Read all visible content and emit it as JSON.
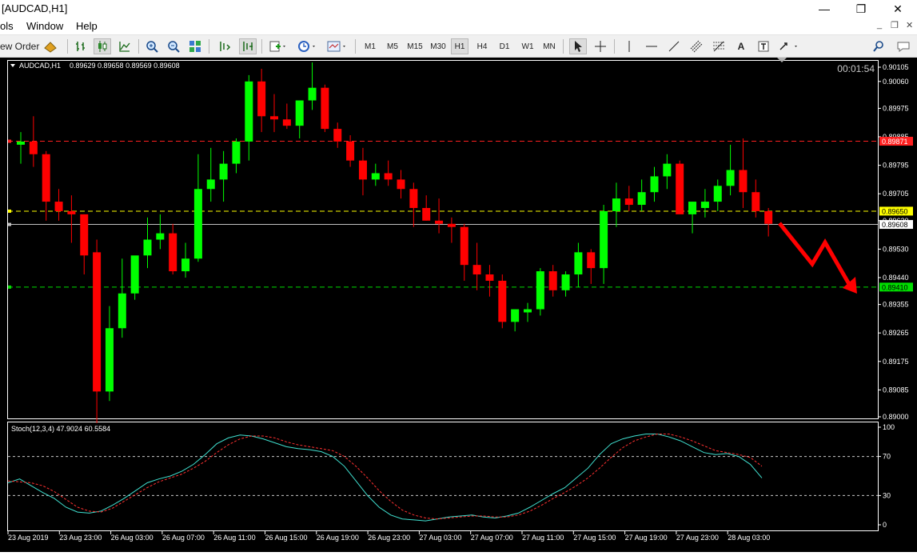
{
  "window": {
    "title": "[AUDCAD,H1]",
    "minimize_glyph": "—",
    "restore_glyph": "❐",
    "close_glyph": "✕"
  },
  "menu": {
    "items": [
      "ols",
      "Window",
      "Help"
    ],
    "mdi_minimize": "_",
    "mdi_restore": "❐",
    "mdi_close": "✕"
  },
  "toolbar": {
    "new_order_label": "ew Order",
    "timeframes": [
      "M1",
      "M5",
      "M15",
      "M30",
      "H1",
      "H4",
      "D1",
      "W1",
      "MN"
    ],
    "active_timeframe": "H1",
    "text_tool": "A",
    "icons": [
      "autotrading-icon",
      "bar-chart-icon",
      "candlestick-icon",
      "line-chart-icon",
      "zoom-in-icon",
      "zoom-out-icon",
      "tile-windows-icon",
      "chart-shift-icon",
      "autoscroll-icon",
      "indicators-icon",
      "periods-clock-icon",
      "templates-icon",
      "cursor-icon",
      "crosshair-icon",
      "vertical-line-icon",
      "horizontal-line-icon",
      "trendline-icon",
      "fibonacci-icon",
      "channel-icon",
      "text-label-icon",
      "arrows-icon",
      "search-icon",
      "chat-icon"
    ]
  },
  "chart_data": [
    {
      "type": "candlestick",
      "symbol_header": "AUDCAD,H1",
      "ohlc_header": "0.89629 0.89658 0.89569 0.89608",
      "timer": "00:01:54",
      "price_axis_ticks": [
        "0.90105",
        "0.90060",
        "0.89975",
        "0.89885",
        "0.89795",
        "0.89705",
        "0.89620",
        "0.89530",
        "0.89440",
        "0.89355",
        "0.89265",
        "0.89175",
        "0.89085",
        "0.89000"
      ],
      "y_range": [
        0.89,
        0.90105
      ],
      "levels": [
        {
          "price": 0.89871,
          "label": "0.89871",
          "color": "#ff2020",
          "style": "dashed"
        },
        {
          "price": 0.8965,
          "label": "0.89650",
          "color": "#ffff00",
          "style": "dashed"
        },
        {
          "price": 0.89608,
          "label": "0.89608",
          "color": "#c0c0c0",
          "style": "solid"
        },
        {
          "price": 0.8941,
          "label": "0.89410",
          "color": "#00dd00",
          "style": "dashed"
        }
      ],
      "candles": [
        [
          0.8986,
          0.899,
          0.898,
          0.8987
        ],
        [
          0.8987,
          0.8995,
          0.8979,
          0.8983
        ],
        [
          0.8983,
          0.8984,
          0.8962,
          0.8968
        ],
        [
          0.8968,
          0.8972,
          0.8962,
          0.8965
        ],
        [
          0.8965,
          0.897,
          0.8955,
          0.8964
        ],
        [
          0.8964,
          0.8964,
          0.8945,
          0.8951
        ],
        [
          0.8952,
          0.8956,
          0.8898,
          0.8908
        ],
        [
          0.8908,
          0.8935,
          0.8905,
          0.8928
        ],
        [
          0.8928,
          0.895,
          0.8925,
          0.8939
        ],
        [
          0.8939,
          0.895,
          0.8937,
          0.8951
        ],
        [
          0.8951,
          0.8963,
          0.8947,
          0.8956
        ],
        [
          0.8956,
          0.8964,
          0.8953,
          0.8958
        ],
        [
          0.8958,
          0.8961,
          0.8945,
          0.8946
        ],
        [
          0.8946,
          0.8955,
          0.8944,
          0.895
        ],
        [
          0.895,
          0.8983,
          0.8949,
          0.8972
        ],
        [
          0.8972,
          0.8985,
          0.8968,
          0.8975
        ],
        [
          0.8975,
          0.8984,
          0.8968,
          0.898
        ],
        [
          0.898,
          0.8988,
          0.8977,
          0.8987
        ],
        [
          0.8987,
          0.9008,
          0.8981,
          0.9006
        ],
        [
          0.9006,
          0.901,
          0.899,
          0.8995
        ],
        [
          0.8995,
          0.9002,
          0.899,
          0.8994
        ],
        [
          0.8994,
          0.8999,
          0.8991,
          0.8992
        ],
        [
          0.8992,
          0.9,
          0.8988,
          0.9
        ],
        [
          0.9,
          0.9012,
          0.8997,
          0.9004
        ],
        [
          0.9004,
          0.9005,
          0.899,
          0.8991
        ],
        [
          0.8991,
          0.8993,
          0.8985,
          0.8987
        ],
        [
          0.8987,
          0.8989,
          0.8979,
          0.8981
        ],
        [
          0.8981,
          0.8985,
          0.897,
          0.8975
        ],
        [
          0.8975,
          0.898,
          0.8973,
          0.8977
        ],
        [
          0.8977,
          0.8981,
          0.8973,
          0.8975
        ],
        [
          0.8975,
          0.8978,
          0.8969,
          0.8972
        ],
        [
          0.8972,
          0.8974,
          0.896,
          0.8966
        ],
        [
          0.8966,
          0.897,
          0.8962,
          0.8962
        ],
        [
          0.8962,
          0.8969,
          0.8958,
          0.8961
        ],
        [
          0.8961,
          0.8963,
          0.8955,
          0.896
        ],
        [
          0.896,
          0.8961,
          0.8943,
          0.8948
        ],
        [
          0.8948,
          0.8955,
          0.894,
          0.8945
        ],
        [
          0.8945,
          0.8948,
          0.8938,
          0.8943
        ],
        [
          0.8943,
          0.8945,
          0.8928,
          0.893
        ],
        [
          0.893,
          0.8934,
          0.8927,
          0.8934
        ],
        [
          0.8933,
          0.8936,
          0.893,
          0.8934
        ],
        [
          0.8934,
          0.8947,
          0.8932,
          0.8946
        ],
        [
          0.8946,
          0.8948,
          0.8938,
          0.894
        ],
        [
          0.894,
          0.8946,
          0.8938,
          0.8945
        ],
        [
          0.8945,
          0.8955,
          0.8941,
          0.8952
        ],
        [
          0.8952,
          0.8953,
          0.8942,
          0.8947
        ],
        [
          0.8947,
          0.8967,
          0.8942,
          0.8965
        ],
        [
          0.8965,
          0.8974,
          0.896,
          0.8969
        ],
        [
          0.8969,
          0.8973,
          0.8965,
          0.8967
        ],
        [
          0.8967,
          0.8975,
          0.8965,
          0.8971
        ],
        [
          0.8971,
          0.8979,
          0.8968,
          0.8976
        ],
        [
          0.8976,
          0.8983,
          0.8972,
          0.898
        ],
        [
          0.898,
          0.8981,
          0.8965,
          0.8964
        ],
        [
          0.8964,
          0.8968,
          0.8958,
          0.8968
        ],
        [
          0.8966,
          0.8972,
          0.8963,
          0.8968
        ],
        [
          0.8968,
          0.8975,
          0.8965,
          0.8973
        ],
        [
          0.8973,
          0.8986,
          0.897,
          0.8978
        ],
        [
          0.8978,
          0.8988,
          0.8966,
          0.8971
        ],
        [
          0.8971,
          0.8975,
          0.8963,
          0.8965
        ],
        [
          0.8965,
          0.8966,
          0.8957,
          0.8961
        ]
      ],
      "bull_color": "#00ff00",
      "bear_color": "#ff0000",
      "forecast_arrow_color": "#ff0000"
    },
    {
      "type": "line",
      "title": "Stoch(12,3,4) 47.9024 60.5584",
      "y_range": [
        0,
        100
      ],
      "y_ticks": [
        "100",
        "70",
        "30",
        "0"
      ],
      "levels": [
        70,
        30
      ],
      "series": [
        {
          "color": "#40e0d0",
          "style": "solid",
          "values": [
            43,
            47,
            40,
            33,
            27,
            18,
            13,
            12,
            14,
            20,
            27,
            35,
            43,
            47,
            50,
            55,
            62,
            72,
            83,
            89,
            92,
            91,
            88,
            84,
            80,
            78,
            77,
            75,
            70,
            60,
            45,
            30,
            18,
            10,
            6,
            5,
            4,
            6,
            8,
            9,
            10,
            8,
            7,
            9,
            12,
            18,
            25,
            32,
            38,
            48,
            58,
            72,
            83,
            88,
            91,
            93,
            93,
            90,
            86,
            80,
            74,
            72,
            73,
            70,
            62,
            48
          ]
        },
        {
          "color": "#ff3030",
          "style": "dashed",
          "values": [
            45,
            44,
            43,
            40,
            34,
            26,
            18,
            14,
            13,
            17,
            24,
            31,
            38,
            44,
            48,
            52,
            58,
            65,
            74,
            82,
            88,
            91,
            91,
            89,
            85,
            82,
            80,
            78,
            76,
            70,
            60,
            48,
            35,
            24,
            15,
            10,
            7,
            6,
            7,
            8,
            9,
            9,
            8,
            8,
            10,
            14,
            20,
            27,
            33,
            40,
            48,
            58,
            69,
            79,
            86,
            90,
            93,
            93,
            90,
            86,
            81,
            76,
            74,
            72,
            69,
            60
          ]
        }
      ]
    }
  ],
  "time_axis": {
    "labels": [
      "23 Aug 2019",
      "23 Aug 23:00",
      "26 Aug 03:00",
      "26 Aug 07:00",
      "26 Aug 11:00",
      "26 Aug 15:00",
      "26 Aug 19:00",
      "26 Aug 23:00",
      "27 Aug 03:00",
      "27 Aug 07:00",
      "27 Aug 11:00",
      "27 Aug 15:00",
      "27 Aug 19:00",
      "27 Aug 23:00",
      "28 Aug 03:00"
    ]
  }
}
